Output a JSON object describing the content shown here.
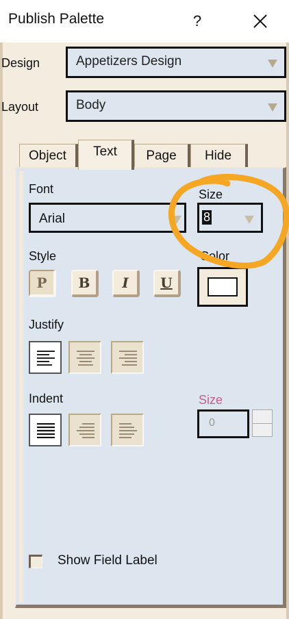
{
  "window": {
    "title": "Publish Palette",
    "help_label": "?",
    "close_label": "✕"
  },
  "design": {
    "label": "Design",
    "value": "Appetizers Design"
  },
  "layout": {
    "label": "Layout",
    "value": "Body"
  },
  "tabs": [
    {
      "label": "Object",
      "active": false
    },
    {
      "label": "Text",
      "active": true
    },
    {
      "label": "Page",
      "active": false
    },
    {
      "label": "Hide",
      "active": false
    }
  ],
  "text_panel": {
    "font": {
      "label": "Font",
      "value": "Arial"
    },
    "size": {
      "label": "Size",
      "value": "8"
    },
    "style": {
      "label": "Style",
      "buttons": [
        {
          "label": "P",
          "pressed": true
        },
        {
          "label": "B",
          "pressed": false
        },
        {
          "label": "I",
          "pressed": false
        },
        {
          "label": "U",
          "pressed": false
        }
      ]
    },
    "color": {
      "label": "Color",
      "swatch": "#ffffff"
    },
    "justify": {
      "label": "Justify",
      "options": [
        "left",
        "center",
        "right"
      ],
      "selected": "left"
    },
    "indent": {
      "label": "Indent",
      "options": [
        "full",
        "first-line",
        "hanging"
      ],
      "selected": "full",
      "size_label": "Size",
      "size_value": "0"
    },
    "show_field_label": {
      "label": "Show Field Label",
      "checked": false
    }
  },
  "annotation": {
    "color": "#f5a623",
    "shape": "hand-drawn circle around Size field"
  },
  "colors": {
    "panel": "#dde6ee",
    "window": "#f4ecdf",
    "accent_disabled": "#c06090"
  }
}
